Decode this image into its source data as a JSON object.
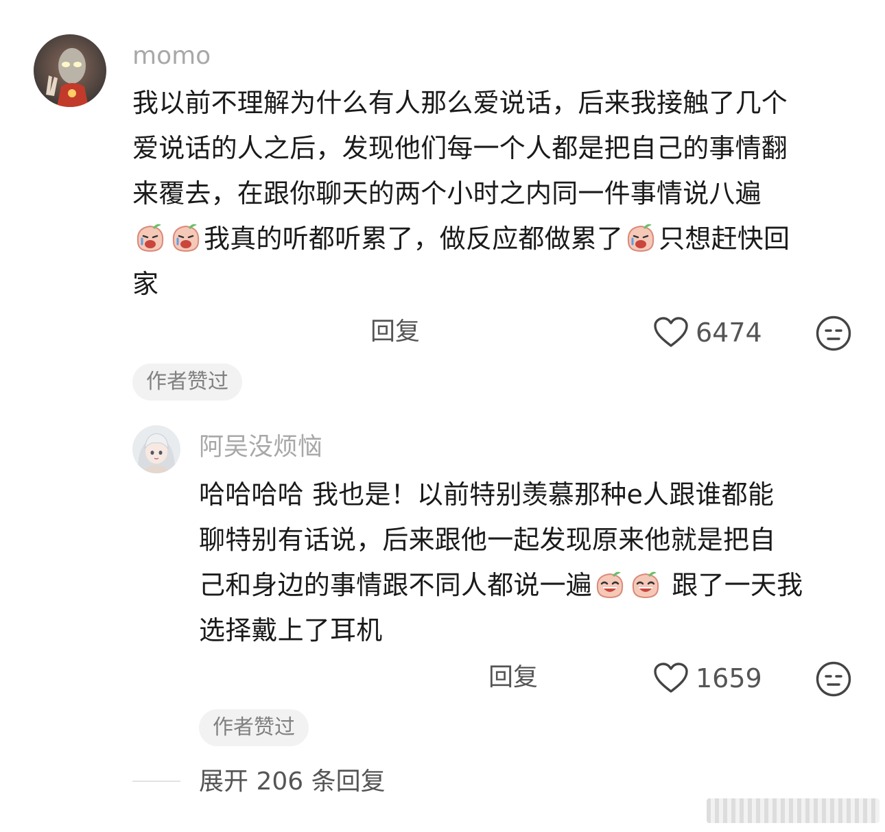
{
  "comments": [
    {
      "username": "momo",
      "lines": [
        "我以前不理解为什么有人那么爱说话，后来我接触了几个",
        "爱说话的人之后，发现他们每一个人都是把自己的事情翻",
        "来覆去，在跟你聊天的两个小时之内同一件事情说八遍"
      ],
      "line4_a": "我真的听都听累了，做反应都做累了",
      "line4_b": "只想赶快回",
      "line5": "家",
      "reply_label": "回复",
      "like_count": "6474",
      "author_liked_badge": "作者赞过",
      "avatar_icon": "ultraman-avatar-icon"
    },
    {
      "username": "阿吴没烦恼",
      "lines": [
        "哈哈哈哈 我也是！以前特别羡慕那种e人跟谁都能",
        "聊特别有话说，后来跟他一起发现原来他就是把自"
      ],
      "line3_a": "己和身边的事情跟不同人都说一遍",
      "line3_b": " 跟了一天我",
      "line4": "选择戴上了耳机",
      "reply_label": "回复",
      "like_count": "1659",
      "author_liked_badge": "作者赞过",
      "avatar_icon": "anime-girl-avatar-icon"
    }
  ],
  "expand_replies": "展开 206 条回复",
  "colors": {
    "username": "#a8a8a8",
    "text": "#1a1a1a",
    "secondary": "#555555",
    "badge_bg": "#f2f2f2",
    "emoji_skin": "#f6c8b8"
  },
  "icons": [
    "heart-outline-icon",
    "neutral-face-icon",
    "crying-face-emoji",
    "laughing-face-emoji"
  ]
}
